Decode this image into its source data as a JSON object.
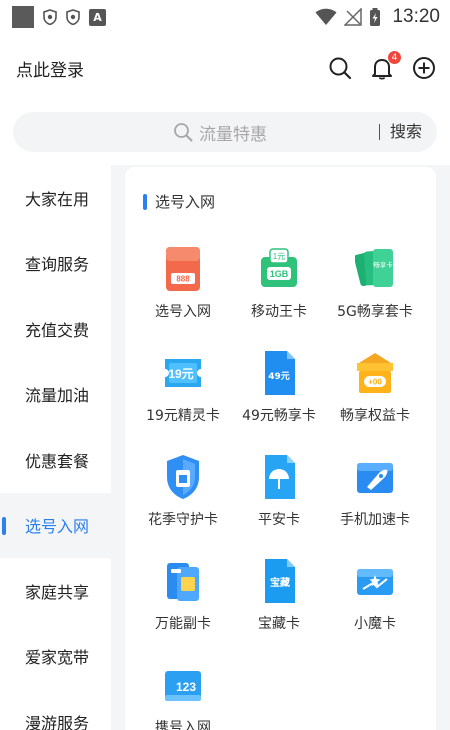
{
  "status_bar": {
    "time": "13:20",
    "a_icon_text": "A"
  },
  "header": {
    "login_text": "点此登录",
    "notification_count": "4"
  },
  "search": {
    "placeholder": "流量特惠",
    "button_label": "搜索"
  },
  "sidebar": {
    "items": [
      {
        "label": "大家在用"
      },
      {
        "label": "查询服务"
      },
      {
        "label": "充值交费"
      },
      {
        "label": "流量加油"
      },
      {
        "label": "优惠套餐"
      },
      {
        "label": "选号入网",
        "active": true
      },
      {
        "label": "家庭共享"
      },
      {
        "label": "爱家宽带"
      },
      {
        "label": "漫游服务"
      }
    ]
  },
  "section": {
    "title": "选号入网",
    "items": [
      {
        "label": "选号入网",
        "icon": "number-card-icon",
        "icon_text": "888"
      },
      {
        "label": "移动王卡",
        "icon": "king-card-icon",
        "icon_text": "1GB"
      },
      {
        "label": "5G畅享套卡",
        "icon": "cards-stack-icon",
        "icon_text": "畅享卡"
      },
      {
        "label": "19元精灵卡",
        "icon": "ticket-19-icon",
        "icon_text": "19元"
      },
      {
        "label": "49元畅享卡",
        "icon": "sim-49-icon",
        "icon_text": "49元"
      },
      {
        "label": "畅享权益卡",
        "icon": "gift-box-icon",
        "icon_text": "+00"
      },
      {
        "label": "花季守护卡",
        "icon": "shield-sim-icon"
      },
      {
        "label": "平安卡",
        "icon": "umbrella-sim-icon"
      },
      {
        "label": "手机加速卡",
        "icon": "rocket-card-icon"
      },
      {
        "label": "万能副卡",
        "icon": "dual-sim-icon"
      },
      {
        "label": "宝藏卡",
        "icon": "treasure-card-icon",
        "icon_text": "宝藏"
      },
      {
        "label": "小魔卡",
        "icon": "magic-card-icon"
      },
      {
        "label": "携号入网",
        "icon": "number-123-icon",
        "icon_text": "123"
      }
    ]
  },
  "colors": {
    "accent": "#2b80f0",
    "badge": "#f0473d",
    "panel_bg": "#f4f5f7"
  }
}
